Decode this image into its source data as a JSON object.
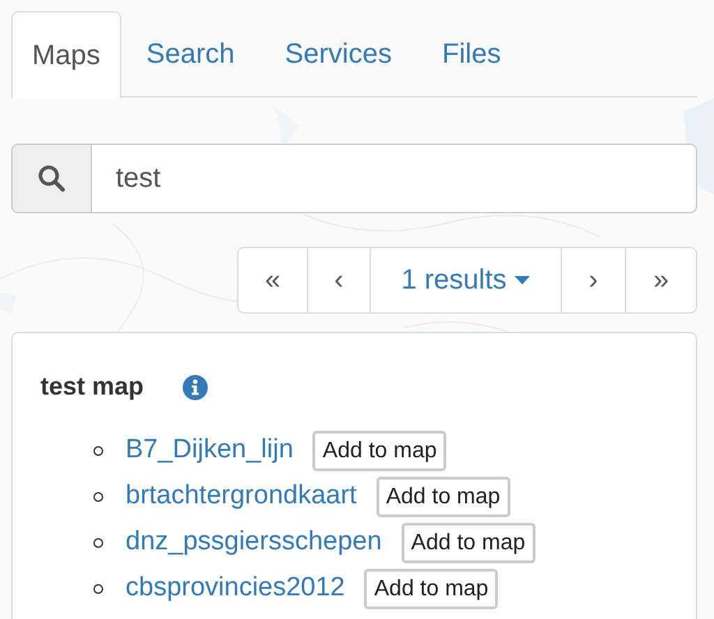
{
  "tabs": [
    {
      "label": "Maps",
      "selected": true
    },
    {
      "label": "Search",
      "selected": false
    },
    {
      "label": "Services",
      "selected": false
    },
    {
      "label": "Files",
      "selected": false
    }
  ],
  "search": {
    "value": "test"
  },
  "pagination": {
    "first": "«",
    "prev": "‹",
    "results": "1 results",
    "next": "›",
    "last": "»"
  },
  "map_panel": {
    "title": "test map",
    "layers": [
      {
        "name": "B7_Dijken_lijn",
        "button": "Add to map"
      },
      {
        "name": "brtachtergrondkaart",
        "button": "Add to map"
      },
      {
        "name": "dnz_pssgiersschepen",
        "button": "Add to map"
      },
      {
        "name": "cbsprovincies2012",
        "button": "Add to map"
      }
    ]
  }
}
